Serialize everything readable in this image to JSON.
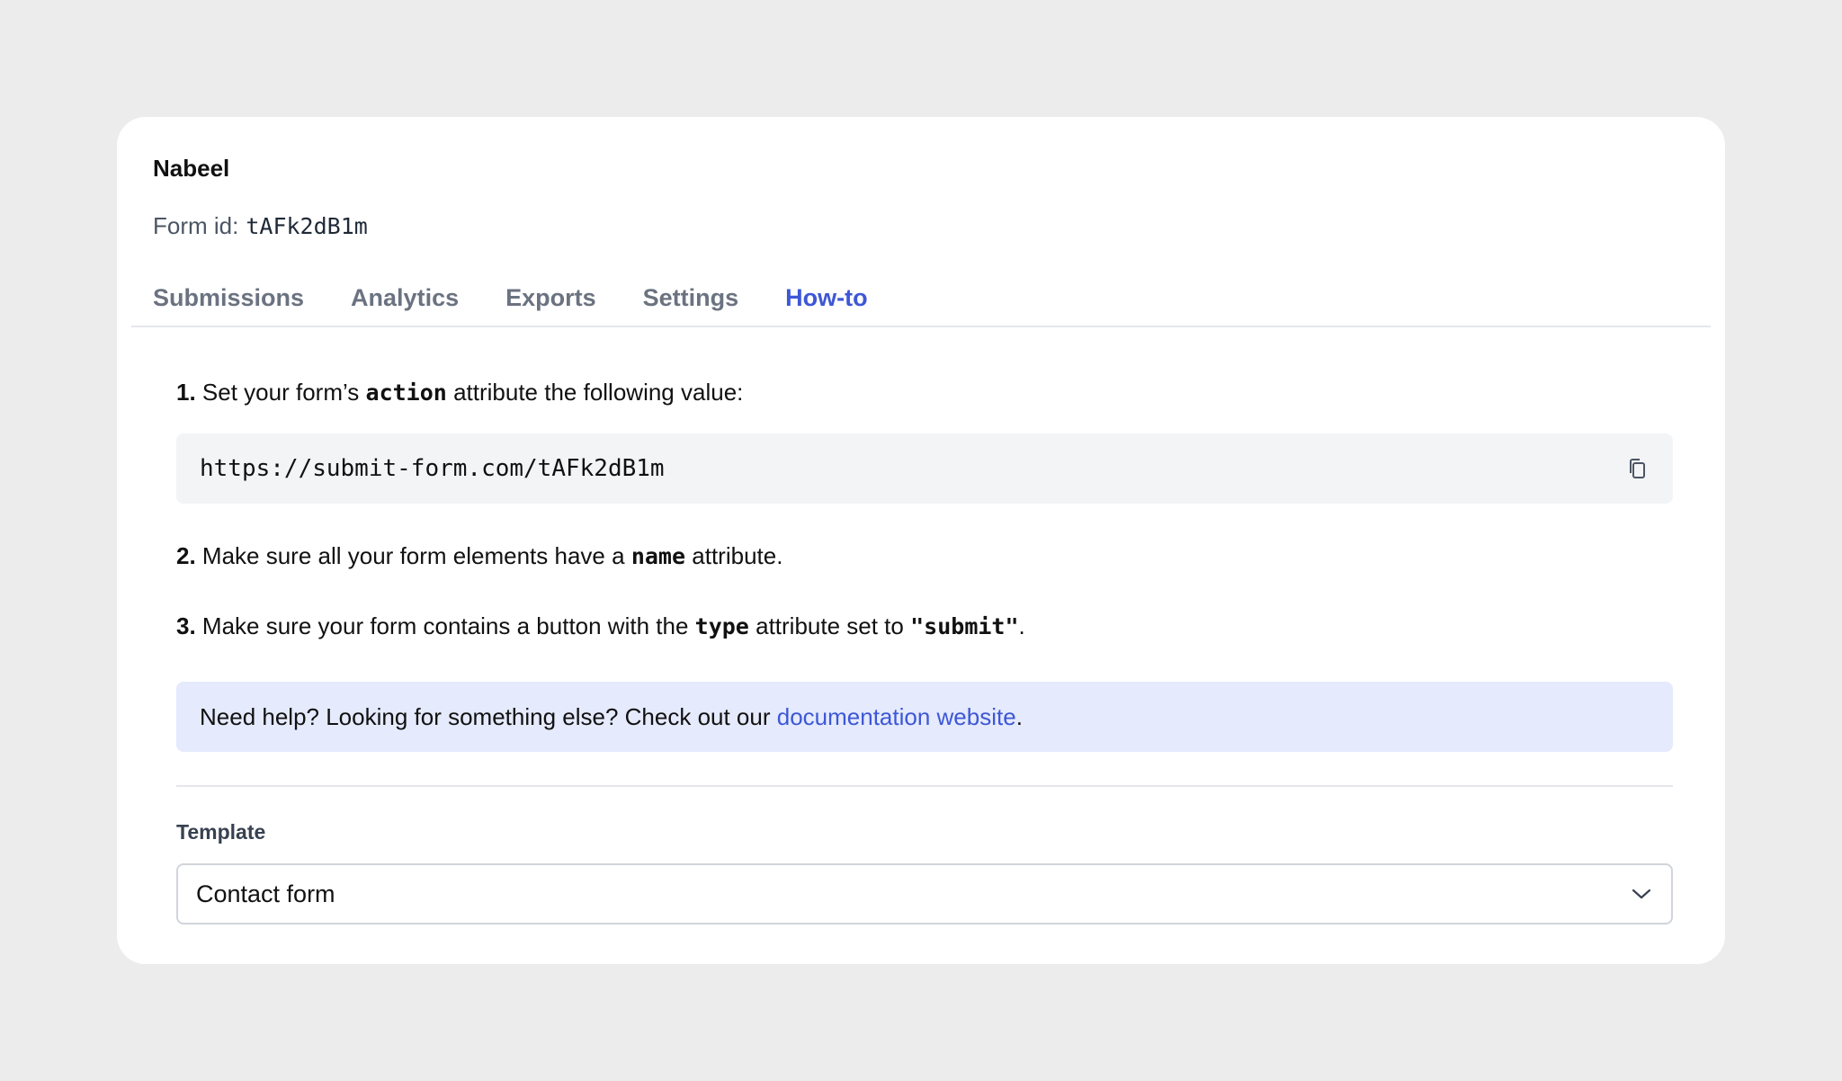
{
  "form": {
    "name": "Nabeel",
    "id_label": "Form id:",
    "id_value": "tAFk2dB1m"
  },
  "tabs": [
    {
      "label": "Submissions",
      "active": false
    },
    {
      "label": "Analytics",
      "active": false
    },
    {
      "label": "Exports",
      "active": false
    },
    {
      "label": "Settings",
      "active": false
    },
    {
      "label": "How-to",
      "active": true
    }
  ],
  "howto": {
    "step1": {
      "number": "1.",
      "text_before": "Set your form’s",
      "code": "action",
      "text_after": "attribute the following value:"
    },
    "action_url": "https://submit-form.com/tAFk2dB1m",
    "copy_icon": "copy-icon",
    "step2": {
      "number": "2.",
      "text_before": "Make sure all your form elements have a",
      "code": "name",
      "text_after": "attribute."
    },
    "step3": {
      "number": "3.",
      "text_before": "Make sure your form contains a button with the",
      "code": "type",
      "text_middle": "attribute set to",
      "code2": "\"submit\"",
      "text_after": "."
    },
    "help": {
      "text": "Need help? Looking for something else? Check out our",
      "link": "documentation website",
      "suffix": "."
    }
  },
  "template": {
    "label": "Template",
    "selected": "Contact form",
    "icon": "chevron-down-icon"
  },
  "colors": {
    "accent": "#3d57d6",
    "background": "#ececec",
    "help_bg": "#e5eafc",
    "code_bg": "#f3f4f6"
  }
}
